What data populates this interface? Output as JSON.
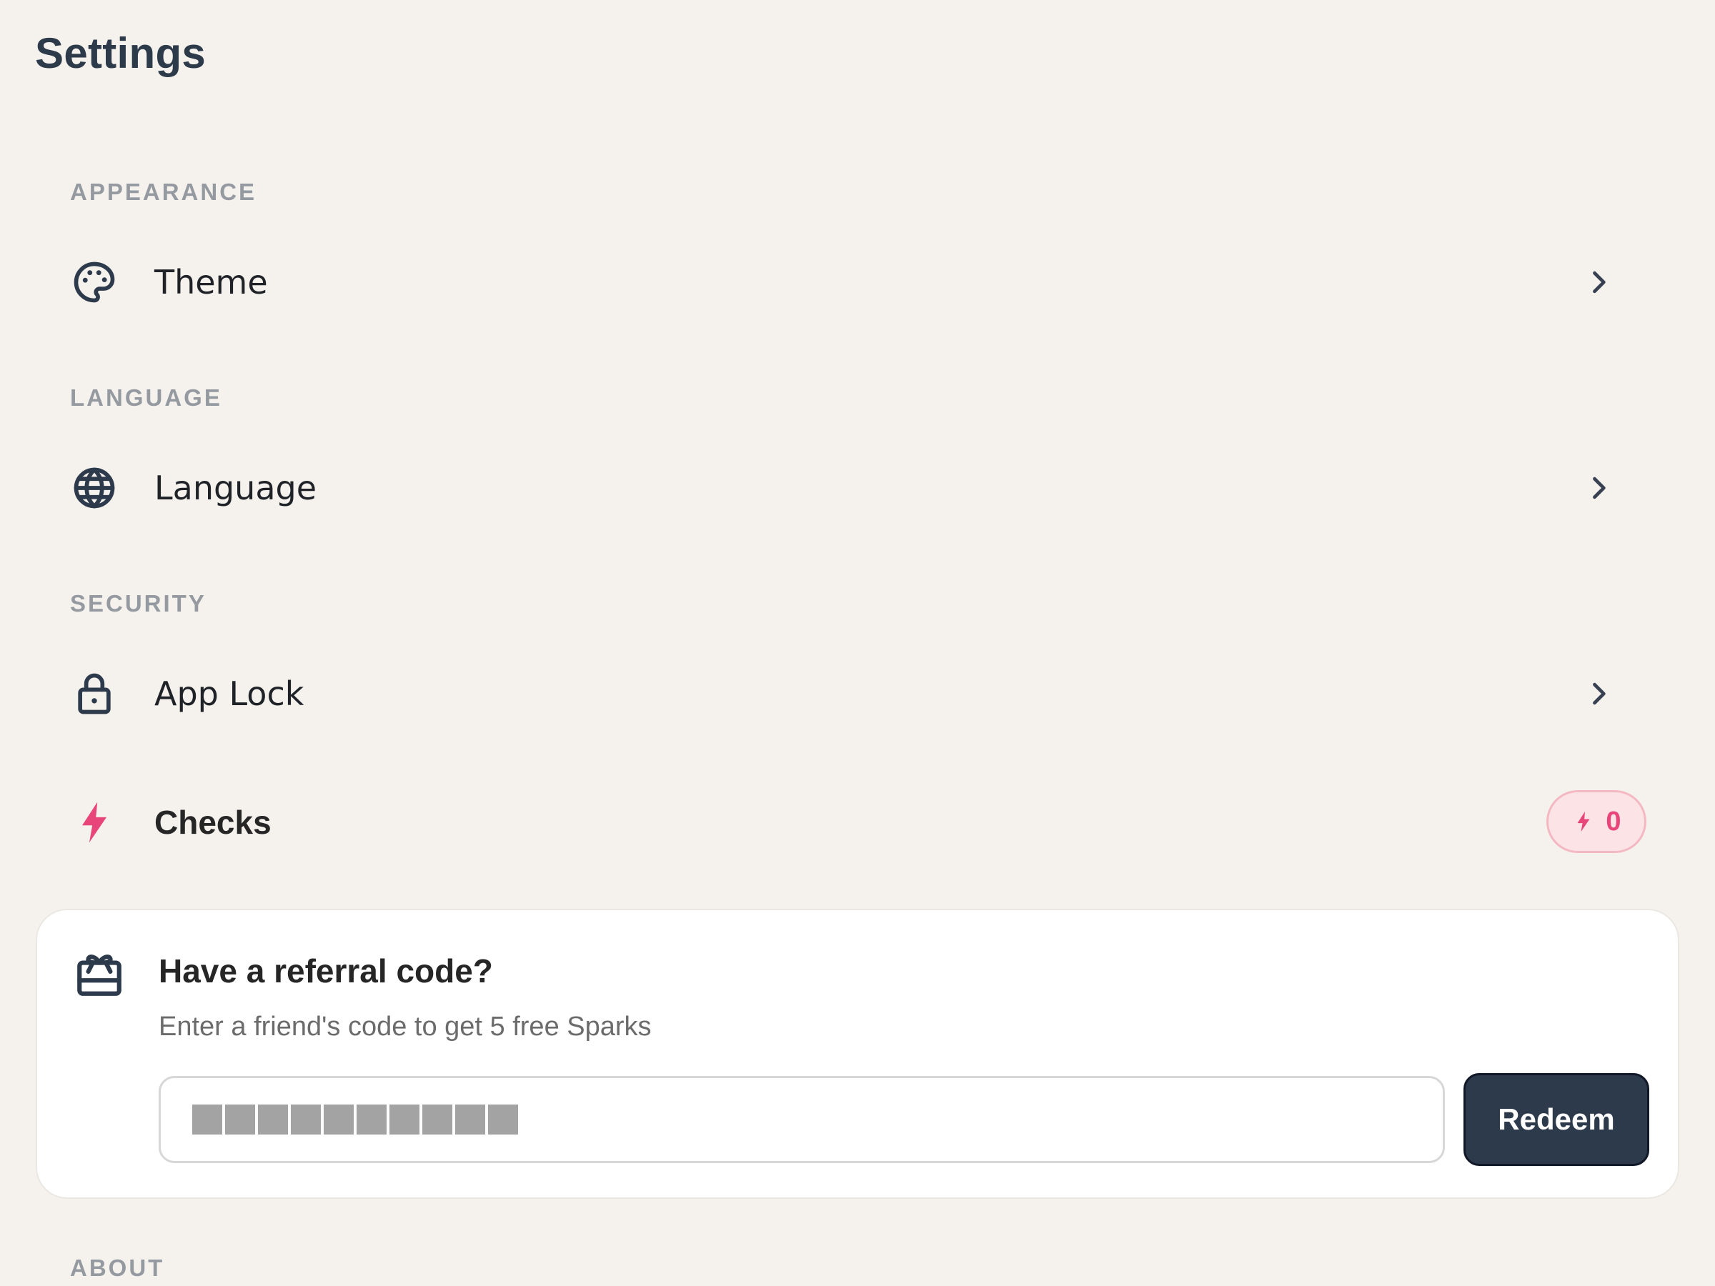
{
  "page": {
    "title": "Settings"
  },
  "sections": {
    "appearance": {
      "label": "APPEARANCE",
      "theme_label": "Theme"
    },
    "language": {
      "label": "LANGUAGE",
      "language_label": "Language"
    },
    "security": {
      "label": "SECURITY",
      "app_lock_label": "App Lock"
    },
    "checks": {
      "label": "Checks",
      "count": "0"
    },
    "about": {
      "label": "ABOUT"
    }
  },
  "referral": {
    "title": "Have a referral code?",
    "subtitle": "Enter a friend's code to get 5 free Sparks",
    "button_label": "Redeem"
  },
  "colors": {
    "background": "#f5f2ee",
    "title": "#2d3a4a",
    "section_label": "#959aa1",
    "accent_pink": "#e8457a",
    "badge_bg": "#fbe3e6",
    "button_bg": "#2c3a4b",
    "card_bg": "#ffffff"
  },
  "icons": {
    "theme": "palette-icon",
    "language": "globe-icon",
    "app_lock": "lock-icon",
    "checks": "lightning-icon",
    "referral": "gift-icon",
    "row_chevron": "chevron-right-icon"
  }
}
